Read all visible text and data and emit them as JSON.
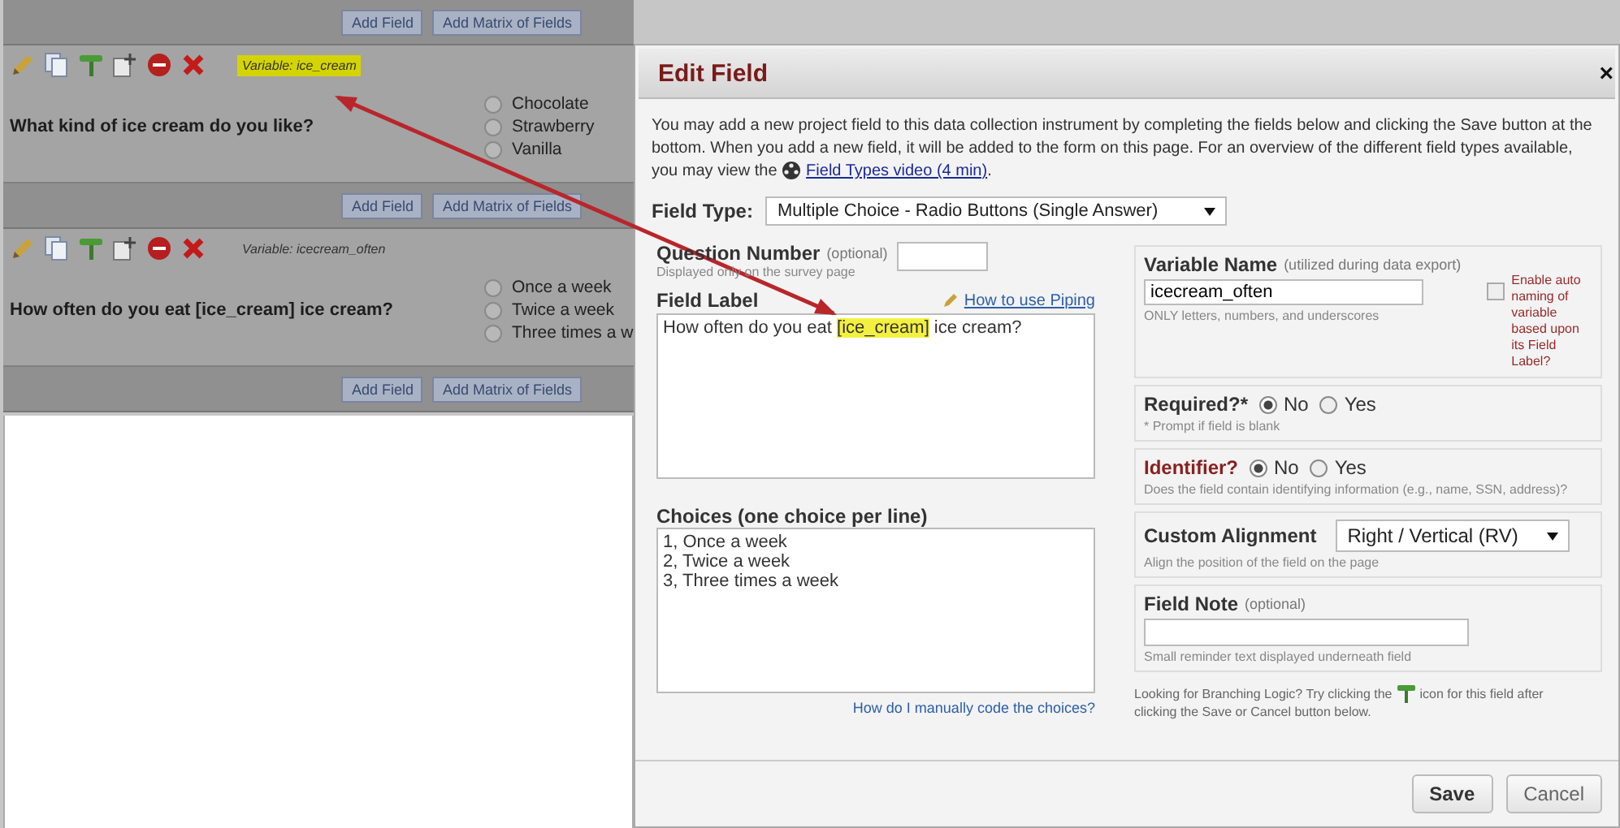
{
  "background_page": {
    "blocks": [
      {
        "kind": "add_bar",
        "buttons": [
          "Add Field",
          "Add Matrix of Fields"
        ]
      },
      {
        "kind": "field",
        "variable": "Variable: ice_cream",
        "highlighted": true,
        "question": "What kind of ice cream do you like?",
        "options": [
          {
            "label": "Chocolate",
            "selected": false
          },
          {
            "label": "Strawberry",
            "selected": false
          },
          {
            "label": "Vanilla",
            "selected": false
          }
        ]
      },
      {
        "kind": "add_bar",
        "buttons": [
          "Add Field",
          "Add Matrix of Fields"
        ]
      },
      {
        "kind": "field",
        "variable": "Variable: icecream_often",
        "highlighted": false,
        "question": "How often do you eat [ice_cream] ice cream?",
        "options": [
          {
            "label": "Once a week",
            "selected": false
          },
          {
            "label": "Twice a week",
            "selected": false
          },
          {
            "label": "Three times a w",
            "selected": false
          }
        ]
      },
      {
        "kind": "add_bar",
        "buttons": [
          "Add Field",
          "Add Matrix of Fields"
        ]
      }
    ]
  },
  "dialog": {
    "title": "Edit Field",
    "close": "×",
    "intro": "You may add a new project field to this data collection instrument by completing the fields below and clicking the Save button at the bottom. When you add a new field, it will be added to the form on this page. For an overview of the different field types available, you may view the",
    "video_link": "Field Types video (4 min)",
    "intro_end": ".",
    "field_type": {
      "label": "Field Type:",
      "value": "Multiple Choice - Radio Buttons (Single Answer)"
    },
    "question_number": {
      "label": "Question Number",
      "hint": "(optional)",
      "note": "Displayed only on the survey page"
    },
    "field_label": {
      "label": "Field Label",
      "piping_link": "How to use Piping",
      "before": "How often do you eat ",
      "piped": "[ice_cream]",
      "after": " ice cream?"
    },
    "choices": {
      "label": "Choices (one choice per line)",
      "lines": [
        "1, Once a week",
        "2, Twice a week",
        "3, Three times a week"
      ],
      "help_link": "How do I manually code the choices?"
    },
    "variable_name": {
      "label": "Variable Name",
      "hint": "(utilized during data export)",
      "value": "icecream_often",
      "note": "ONLY letters, numbers, and underscores",
      "auto_naming": {
        "label": "Enable auto naming of variable based upon its Field Label?",
        "checked": false
      }
    },
    "required": {
      "label": "Required?*",
      "options": [
        {
          "label": "No",
          "selected": true
        },
        {
          "label": "Yes",
          "selected": false
        }
      ],
      "note": "* Prompt if field is blank"
    },
    "identifier": {
      "label": "Identifier?",
      "options": [
        {
          "label": "No",
          "selected": true
        },
        {
          "label": "Yes",
          "selected": false
        }
      ],
      "note": "Does the field contain identifying information (e.g., name, SSN, address)?"
    },
    "custom_alignment": {
      "label": "Custom Alignment",
      "value": "Right / Vertical (RV)",
      "note": "Align the position of the field on the page"
    },
    "field_note": {
      "label": "Field Note",
      "hint": "(optional)",
      "note": "Small reminder text displayed underneath field"
    },
    "branching_before": "Looking for Branching Logic? Try clicking the",
    "branching_after": "icon for this field after",
    "branching_last": "clicking the Save or Cancel button below.",
    "buttons": [
      {
        "label": "Save",
        "kind": "primary"
      },
      {
        "label": "Cancel",
        "kind": "secondary"
      }
    ]
  }
}
